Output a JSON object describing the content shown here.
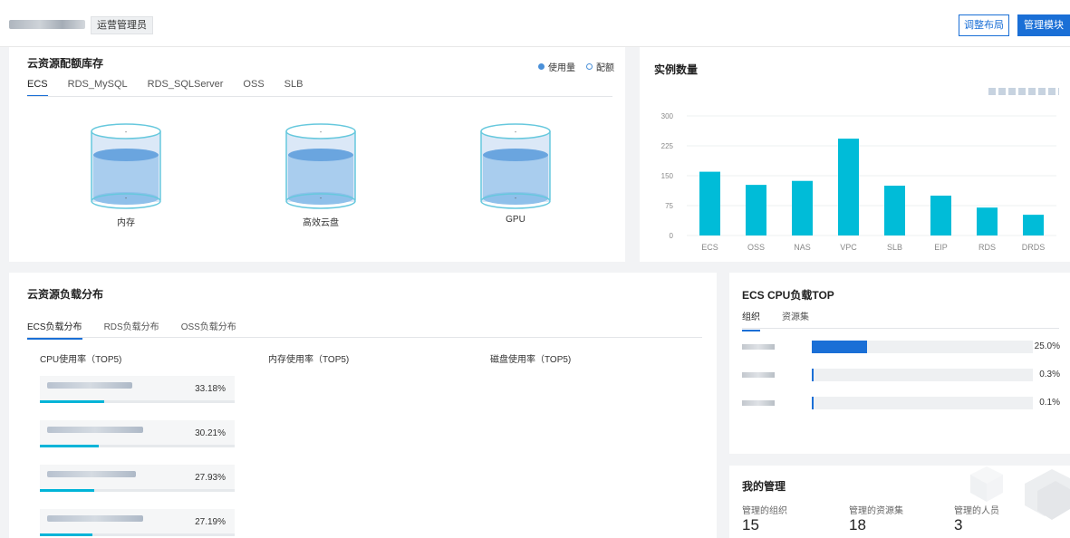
{
  "header": {
    "role_tag": "运营管理员",
    "adjust_layout_label": "调整布局",
    "manage_modules_label": "管理模块"
  },
  "quota": {
    "title": "云资源配额库存",
    "legend_used": "使用量",
    "legend_quota": "配额",
    "tabs": [
      "ECS",
      "RDS_MySQL",
      "RDS_SQLServer",
      "OSS",
      "SLB"
    ],
    "active_tab": "ECS",
    "cylinders": [
      {
        "label": "内存",
        "top_value": "-",
        "bottom_value": "-"
      },
      {
        "label": "高效云盘",
        "top_value": "-",
        "bottom_value": "-"
      },
      {
        "label": "GPU",
        "top_value": "-",
        "bottom_value": "-"
      }
    ]
  },
  "instances": {
    "title": "实例数量",
    "chart_data": {
      "type": "bar",
      "categories": [
        "ECS",
        "OSS",
        "NAS",
        "VPC",
        "SLB",
        "EIP",
        "RDS",
        "DRDS"
      ],
      "values": [
        160,
        127,
        137,
        243,
        125,
        100,
        70,
        52
      ],
      "ylim": [
        0,
        300
      ],
      "yticks": [
        0,
        75,
        150,
        225,
        300
      ],
      "color": "#00bcd8",
      "grid": true
    }
  },
  "load": {
    "title": "云资源负载分布",
    "tabs": [
      "ECS负载分布",
      "RDS负载分布",
      "OSS负载分布"
    ],
    "active_tab": "ECS负载分布",
    "col_cpu": "CPU使用率（TOP5)",
    "col_mem": "内存使用率（TOP5)",
    "col_disk": "磁盘使用率（TOP5)",
    "cpu_items": [
      {
        "value": "33.18%",
        "pct": 0.3318
      },
      {
        "value": "30.21%",
        "pct": 0.3021
      },
      {
        "value": "27.93%",
        "pct": 0.2793
      },
      {
        "value": "27.19%",
        "pct": 0.2719
      }
    ]
  },
  "cpu_top": {
    "title": "ECS CPU负载TOP",
    "tabs": [
      "组织",
      "资源集"
    ],
    "active_tab": "组织",
    "rows": [
      {
        "value": "25.0%",
        "pct": 0.25
      },
      {
        "value": "0.3%",
        "pct": 0.003
      },
      {
        "value": "0.1%",
        "pct": 0.001
      }
    ]
  },
  "mgmt": {
    "title": "我的管理",
    "items": [
      {
        "label": "管理的组织",
        "value": "15"
      },
      {
        "label": "管理的资源集",
        "value": "18"
      },
      {
        "label": "管理的人员",
        "value": "3"
      }
    ]
  }
}
